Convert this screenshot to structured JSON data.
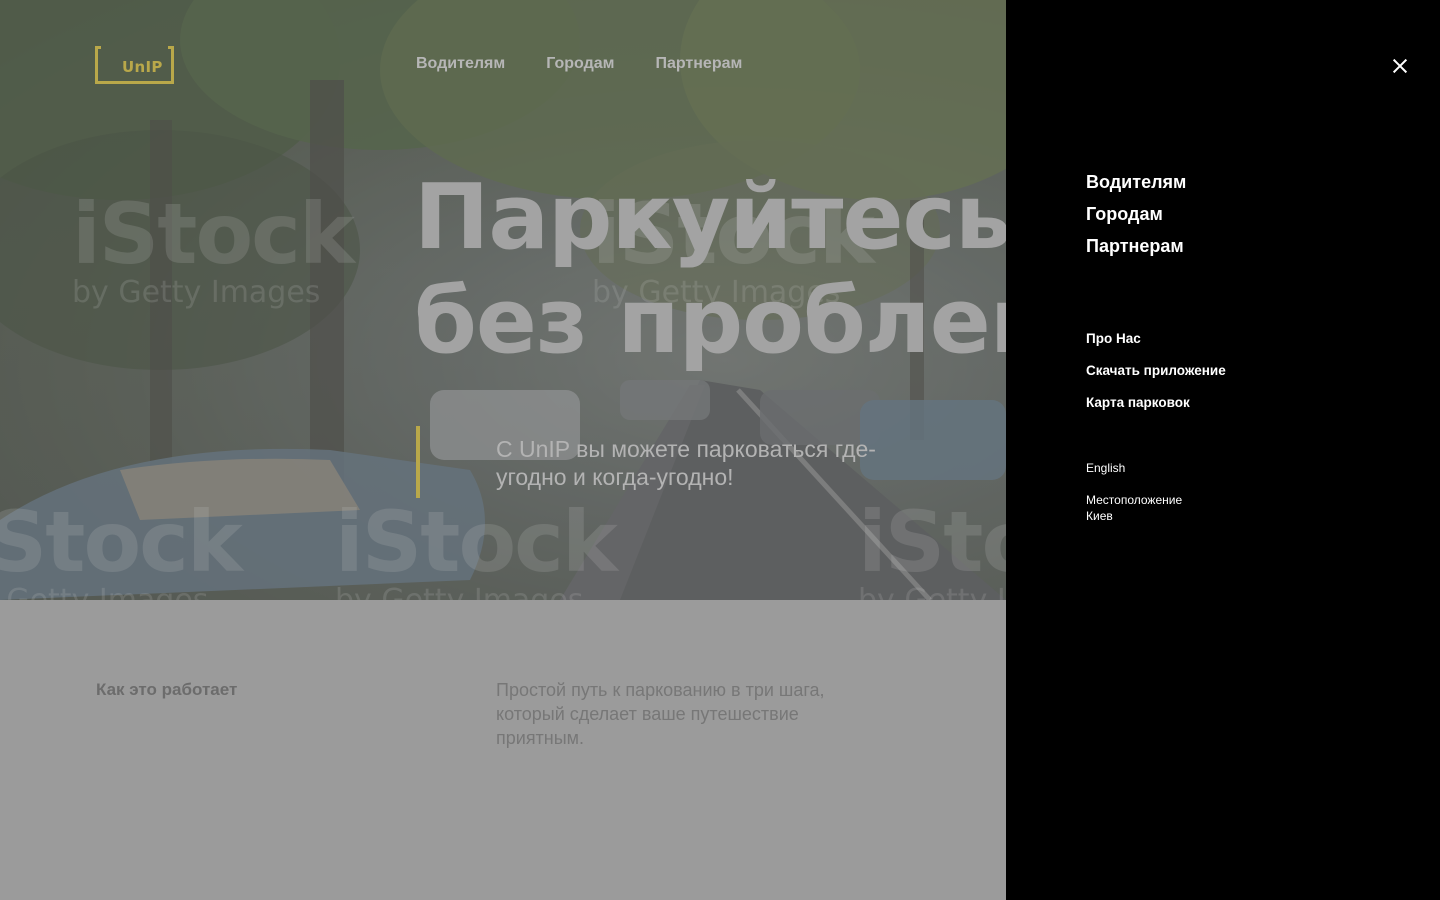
{
  "brand": {
    "logo_text": "UnIP",
    "accent_color": "#b9a84a"
  },
  "header": {
    "nav": [
      {
        "label": "Водителям"
      },
      {
        "label": "Городам"
      },
      {
        "label": "Партнерам"
      }
    ]
  },
  "hero": {
    "headline_line1": "Паркуйтесь",
    "headline_line2": "без проблем",
    "subtitle": "С UnIP вы можете парковаться где-угодно и когда-угодно!",
    "watermark_big": "iStock",
    "watermark_small": "by Getty Images"
  },
  "how_it_works": {
    "title": "Как это работает",
    "text": "Простой путь к паркованию в три шага, который сделает ваше путешествие приятным."
  },
  "side_menu": {
    "close_icon": "close-icon",
    "main_items": [
      {
        "label": "Водителям"
      },
      {
        "label": "Городам"
      },
      {
        "label": "Партнерам"
      }
    ],
    "secondary_items": [
      {
        "label": "Про Нас"
      },
      {
        "label": "Скачать приложение"
      },
      {
        "label": "Карта парковок"
      }
    ],
    "language": "English",
    "location_label": "Местоположение",
    "location_value": "Киев"
  }
}
